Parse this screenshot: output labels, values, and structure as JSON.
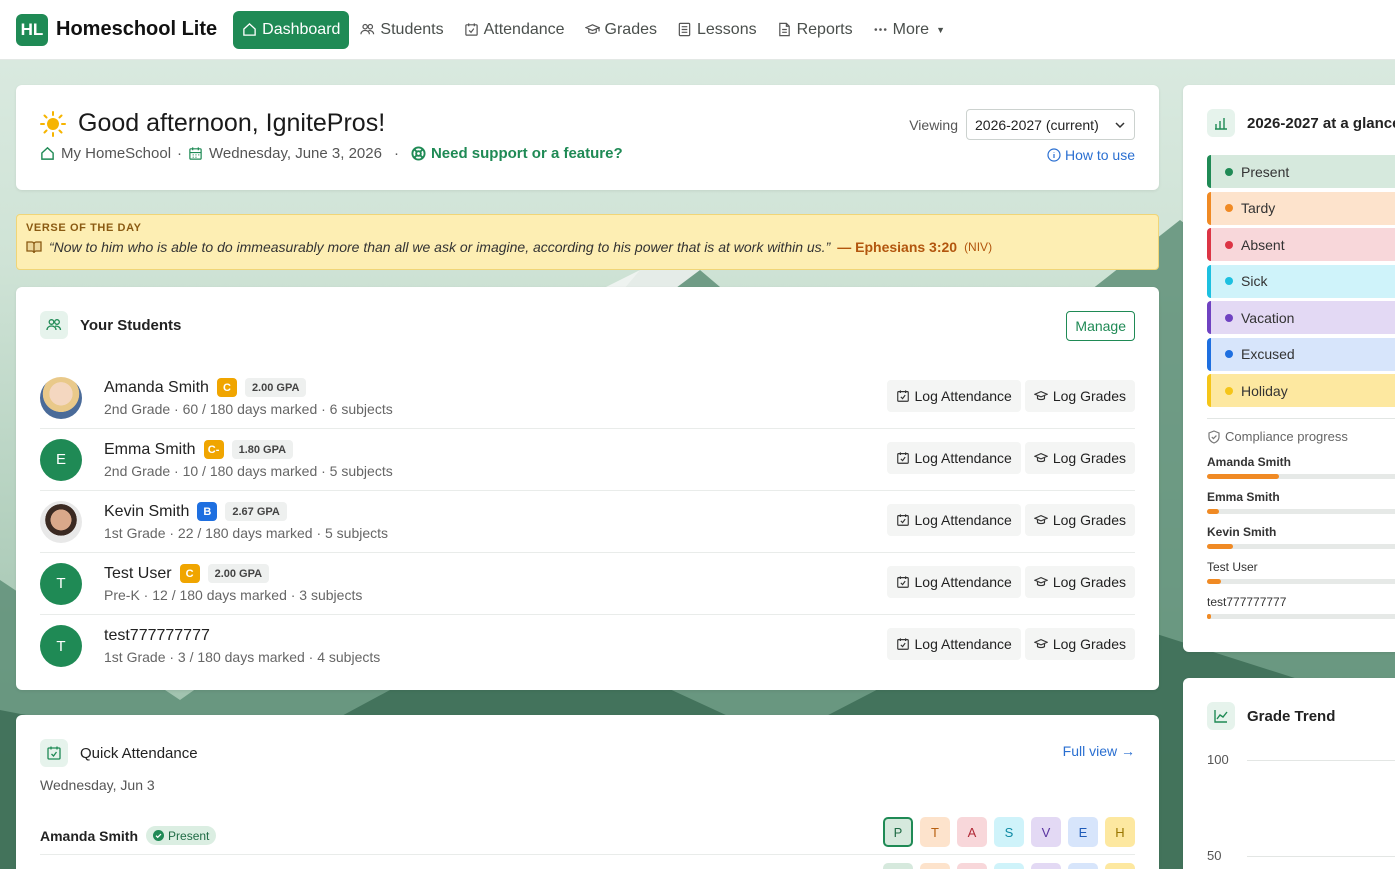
{
  "nav": {
    "brand_logo": "HL",
    "brand_name": "Homeschool Lite",
    "items": [
      {
        "label": "Dashboard",
        "icon": "home-icon",
        "active": true
      },
      {
        "label": "Students",
        "icon": "users-icon"
      },
      {
        "label": "Attendance",
        "icon": "calendar-check-icon"
      },
      {
        "label": "Grades",
        "icon": "graduation-cap-icon"
      },
      {
        "label": "Lessons",
        "icon": "list-icon"
      },
      {
        "label": "Reports",
        "icon": "document-icon"
      },
      {
        "label": "More",
        "icon": "ellipsis-icon"
      }
    ]
  },
  "greeting": {
    "title": "Good afternoon, IgnitePros!",
    "school": "My HomeSchool",
    "date": "Wednesday, June 3, 2026",
    "support": "Need support or a feature?",
    "viewing_label": "Viewing",
    "viewing_value": "2026-2027 (current)",
    "how_to_use": "How to use"
  },
  "verse": {
    "heading": "VERSE OF THE DAY",
    "text": "“Now to him who is able to do immeasurably more than all we ask or imagine, according to his power that is at work within us.”",
    "reference": "— Ephesians 3:20",
    "version": "(NIV)"
  },
  "students": {
    "title": "Your Students",
    "manage": "Manage",
    "log_attendance": "Log Attendance",
    "log_grades": "Log Grades",
    "list": [
      {
        "name": "Amanda Smith",
        "initial": "",
        "grade_letter": "C",
        "grade_color": "#f0a500",
        "gpa": "2.00 GPA",
        "sub": "2nd Grade · 60 / 180 days marked · 6 subjects"
      },
      {
        "name": "Emma Smith",
        "initial": "E",
        "grade_letter": "C-",
        "grade_color": "#f0a500",
        "gpa": "1.80 GPA",
        "sub": "2nd Grade · 10 / 180 days marked · 5 subjects"
      },
      {
        "name": "Kevin Smith",
        "initial": "",
        "grade_letter": "B",
        "grade_color": "#1e6fe0",
        "gpa": "2.67 GPA",
        "sub": "1st Grade · 22 / 180 days marked · 5 subjects"
      },
      {
        "name": "Test User",
        "initial": "T",
        "grade_letter": "C",
        "grade_color": "#f0a500",
        "gpa": "2.00 GPA",
        "sub": "Pre-K · 12 / 180 days marked · 3 subjects"
      },
      {
        "name": "test777777777",
        "initial": "T",
        "grade_letter": "",
        "grade_color": "",
        "gpa": "",
        "sub": "1st Grade · 3 / 180 days marked · 4 subjects"
      }
    ]
  },
  "quick_attendance": {
    "title": "Quick Attendance",
    "full_view": "Full view →",
    "date": "Wednesday, Jun 3",
    "row_name": "Amanda Smith",
    "row_status": "Present",
    "buttons": [
      "P",
      "T",
      "A",
      "S",
      "V",
      "E",
      "H"
    ]
  },
  "glance": {
    "title": "2026-2027 at a glance",
    "statuses": [
      {
        "label": "Present",
        "color": "#1f8a55",
        "bg": "#d6e9dd"
      },
      {
        "label": "Tardy",
        "color": "#f08a24",
        "bg": "#fde3cc"
      },
      {
        "label": "Absent",
        "color": "#dc3545",
        "bg": "#f8d7da"
      },
      {
        "label": "Sick",
        "color": "#1cc0e0",
        "bg": "#cff3fa"
      },
      {
        "label": "Vacation",
        "color": "#6f42c1",
        "bg": "#e3d9f4"
      },
      {
        "label": "Excused",
        "color": "#1e6fe0",
        "bg": "#d7e5fb"
      },
      {
        "label": "Holiday",
        "color": "#f5c518",
        "bg": "#fde8a0"
      }
    ],
    "compliance_title": "Compliance progress",
    "compliance": [
      {
        "name": "Amanda Smith",
        "progress": 0.333
      },
      {
        "name": "Emma Smith",
        "progress": 0.056
      },
      {
        "name": "Kevin Smith",
        "progress": 0.122
      },
      {
        "name": "Test User",
        "progress": 0.067
      },
      {
        "name": "test777777777",
        "progress": 0.017
      }
    ]
  },
  "trend": {
    "title": "Grade Trend",
    "y_ticks": [
      "100",
      "50"
    ]
  }
}
